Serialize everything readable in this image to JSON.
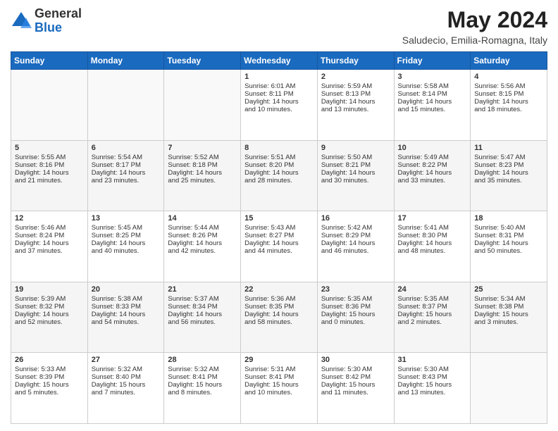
{
  "logo": {
    "general": "General",
    "blue": "Blue"
  },
  "header": {
    "title": "May 2024",
    "subtitle": "Saludecio, Emilia-Romagna, Italy"
  },
  "days_of_week": [
    "Sunday",
    "Monday",
    "Tuesday",
    "Wednesday",
    "Thursday",
    "Friday",
    "Saturday"
  ],
  "weeks": [
    [
      {
        "day": "",
        "info": ""
      },
      {
        "day": "",
        "info": ""
      },
      {
        "day": "",
        "info": ""
      },
      {
        "day": "1",
        "info": "Sunrise: 6:01 AM\nSunset: 8:11 PM\nDaylight: 14 hours\nand 10 minutes."
      },
      {
        "day": "2",
        "info": "Sunrise: 5:59 AM\nSunset: 8:13 PM\nDaylight: 14 hours\nand 13 minutes."
      },
      {
        "day": "3",
        "info": "Sunrise: 5:58 AM\nSunset: 8:14 PM\nDaylight: 14 hours\nand 15 minutes."
      },
      {
        "day": "4",
        "info": "Sunrise: 5:56 AM\nSunset: 8:15 PM\nDaylight: 14 hours\nand 18 minutes."
      }
    ],
    [
      {
        "day": "5",
        "info": "Sunrise: 5:55 AM\nSunset: 8:16 PM\nDaylight: 14 hours\nand 21 minutes."
      },
      {
        "day": "6",
        "info": "Sunrise: 5:54 AM\nSunset: 8:17 PM\nDaylight: 14 hours\nand 23 minutes."
      },
      {
        "day": "7",
        "info": "Sunrise: 5:52 AM\nSunset: 8:18 PM\nDaylight: 14 hours\nand 25 minutes."
      },
      {
        "day": "8",
        "info": "Sunrise: 5:51 AM\nSunset: 8:20 PM\nDaylight: 14 hours\nand 28 minutes."
      },
      {
        "day": "9",
        "info": "Sunrise: 5:50 AM\nSunset: 8:21 PM\nDaylight: 14 hours\nand 30 minutes."
      },
      {
        "day": "10",
        "info": "Sunrise: 5:49 AM\nSunset: 8:22 PM\nDaylight: 14 hours\nand 33 minutes."
      },
      {
        "day": "11",
        "info": "Sunrise: 5:47 AM\nSunset: 8:23 PM\nDaylight: 14 hours\nand 35 minutes."
      }
    ],
    [
      {
        "day": "12",
        "info": "Sunrise: 5:46 AM\nSunset: 8:24 PM\nDaylight: 14 hours\nand 37 minutes."
      },
      {
        "day": "13",
        "info": "Sunrise: 5:45 AM\nSunset: 8:25 PM\nDaylight: 14 hours\nand 40 minutes."
      },
      {
        "day": "14",
        "info": "Sunrise: 5:44 AM\nSunset: 8:26 PM\nDaylight: 14 hours\nand 42 minutes."
      },
      {
        "day": "15",
        "info": "Sunrise: 5:43 AM\nSunset: 8:27 PM\nDaylight: 14 hours\nand 44 minutes."
      },
      {
        "day": "16",
        "info": "Sunrise: 5:42 AM\nSunset: 8:29 PM\nDaylight: 14 hours\nand 46 minutes."
      },
      {
        "day": "17",
        "info": "Sunrise: 5:41 AM\nSunset: 8:30 PM\nDaylight: 14 hours\nand 48 minutes."
      },
      {
        "day": "18",
        "info": "Sunrise: 5:40 AM\nSunset: 8:31 PM\nDaylight: 14 hours\nand 50 minutes."
      }
    ],
    [
      {
        "day": "19",
        "info": "Sunrise: 5:39 AM\nSunset: 8:32 PM\nDaylight: 14 hours\nand 52 minutes."
      },
      {
        "day": "20",
        "info": "Sunrise: 5:38 AM\nSunset: 8:33 PM\nDaylight: 14 hours\nand 54 minutes."
      },
      {
        "day": "21",
        "info": "Sunrise: 5:37 AM\nSunset: 8:34 PM\nDaylight: 14 hours\nand 56 minutes."
      },
      {
        "day": "22",
        "info": "Sunrise: 5:36 AM\nSunset: 8:35 PM\nDaylight: 14 hours\nand 58 minutes."
      },
      {
        "day": "23",
        "info": "Sunrise: 5:35 AM\nSunset: 8:36 PM\nDaylight: 15 hours\nand 0 minutes."
      },
      {
        "day": "24",
        "info": "Sunrise: 5:35 AM\nSunset: 8:37 PM\nDaylight: 15 hours\nand 2 minutes."
      },
      {
        "day": "25",
        "info": "Sunrise: 5:34 AM\nSunset: 8:38 PM\nDaylight: 15 hours\nand 3 minutes."
      }
    ],
    [
      {
        "day": "26",
        "info": "Sunrise: 5:33 AM\nSunset: 8:39 PM\nDaylight: 15 hours\nand 5 minutes."
      },
      {
        "day": "27",
        "info": "Sunrise: 5:32 AM\nSunset: 8:40 PM\nDaylight: 15 hours\nand 7 minutes."
      },
      {
        "day": "28",
        "info": "Sunrise: 5:32 AM\nSunset: 8:41 PM\nDaylight: 15 hours\nand 8 minutes."
      },
      {
        "day": "29",
        "info": "Sunrise: 5:31 AM\nSunset: 8:41 PM\nDaylight: 15 hours\nand 10 minutes."
      },
      {
        "day": "30",
        "info": "Sunrise: 5:30 AM\nSunset: 8:42 PM\nDaylight: 15 hours\nand 11 minutes."
      },
      {
        "day": "31",
        "info": "Sunrise: 5:30 AM\nSunset: 8:43 PM\nDaylight: 15 hours\nand 13 minutes."
      },
      {
        "day": "",
        "info": ""
      }
    ]
  ]
}
